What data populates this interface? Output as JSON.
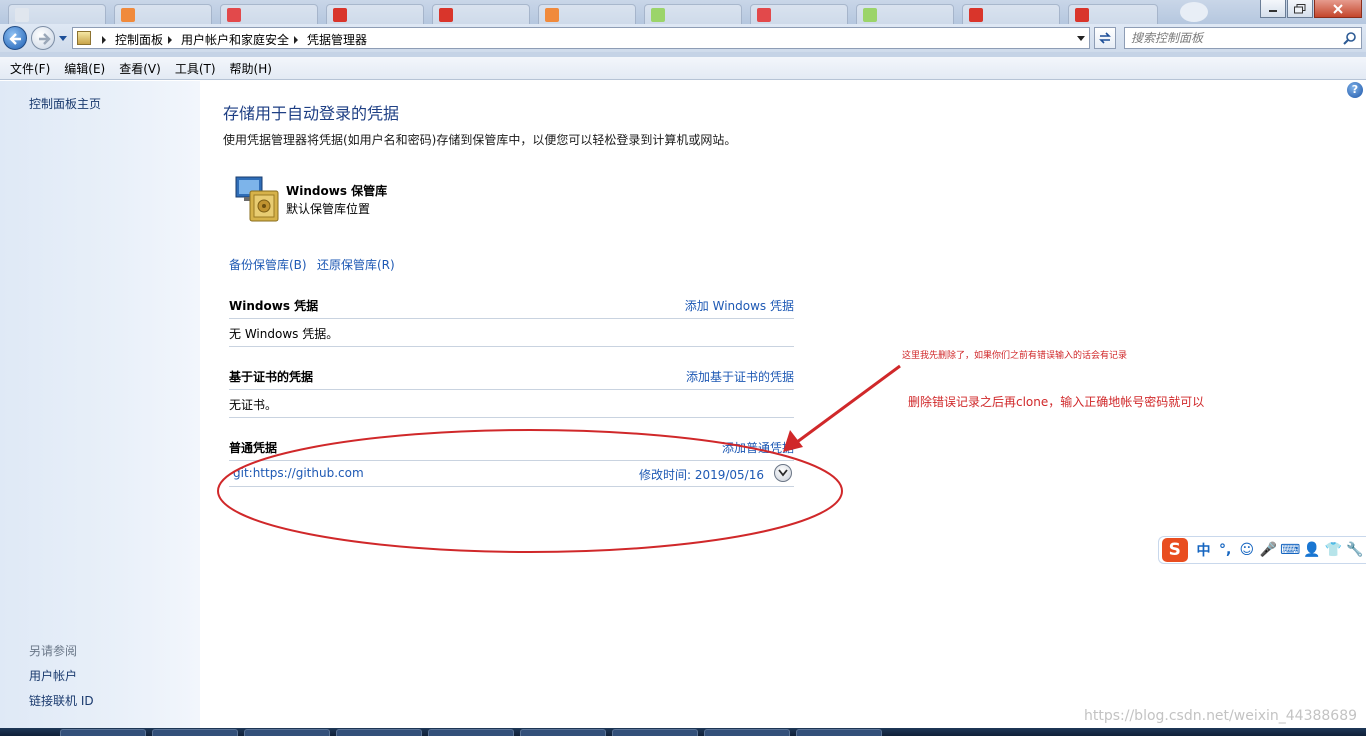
{
  "address": {
    "crumbs": [
      "控制面板",
      "用户帐户和家庭安全",
      "凭据管理器"
    ],
    "search_placeholder": "搜索控制面板"
  },
  "menu": [
    "文件(F)",
    "编辑(E)",
    "查看(V)",
    "工具(T)",
    "帮助(H)"
  ],
  "sidebar": {
    "home": "控制面板主页",
    "see_also": "另请参阅",
    "links": [
      "用户帐户",
      "链接联机 ID"
    ]
  },
  "main": {
    "help": "?",
    "title": "存储用于自动登录的凭据",
    "description": "使用凭据管理器将凭据(如用户名和密码)存储到保管库中，以便您可以轻松登录到计算机或网站。",
    "vault_name": "Windows 保管库",
    "vault_location": "默认保管库位置",
    "backup_link": "备份保管库(B)",
    "restore_link": "还原保管库(R)",
    "sections": [
      {
        "heading": "Windows 凭据",
        "add": "添加 Windows 凭据",
        "empty": "无 Windows 凭据。"
      },
      {
        "heading": "基于证书的凭据",
        "add": "添加基于证书的凭据",
        "empty": "无证书。"
      },
      {
        "heading": "普通凭据",
        "add": "添加普通凭据"
      }
    ],
    "generic_credential": {
      "name": "git:https://github.com",
      "modified": "修改时间:  2019/05/16"
    }
  },
  "annotations": {
    "note1": "这里我先删除了，如果你们之前有错误输入的话会有记录",
    "note2": "删除错误记录之后再clone，输入正确地帐号密码就可以",
    "color": "#d0282a"
  },
  "ime": {
    "logo": "S",
    "items": [
      "中",
      "°,",
      "☺",
      "🎤",
      "⌨",
      "👤",
      "👕",
      "🔧"
    ]
  },
  "watermark": "https://blog.csdn.net/weixin_44388689"
}
